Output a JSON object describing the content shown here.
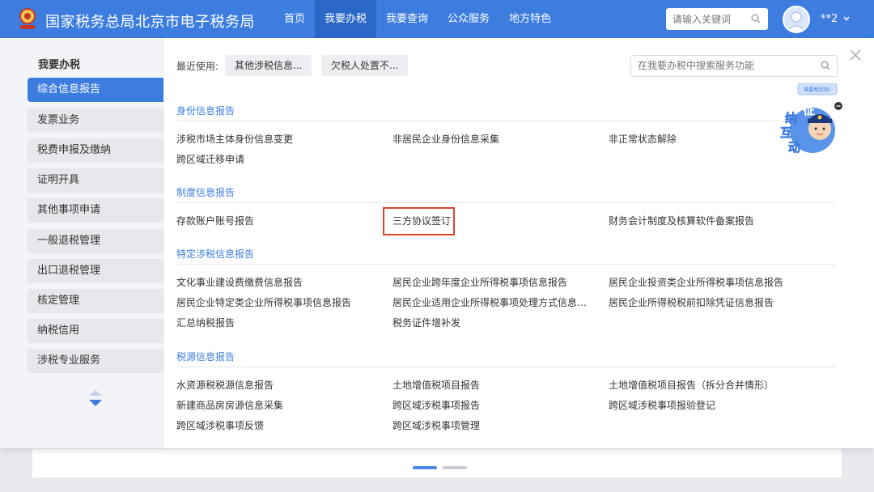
{
  "header": {
    "title": "国家税务总局北京市电子税务局",
    "nav": [
      "首页",
      "我要办税",
      "我要查询",
      "公众服务",
      "地方特色"
    ],
    "active_nav": "我要办税",
    "search_placeholder": "请输入关键词",
    "username": "**2"
  },
  "sidebar": {
    "title": "我要办税",
    "items": [
      "综合信息报告",
      "发票业务",
      "税费申报及缴纳",
      "证明开具",
      "其他事项申请",
      "一般退税管理",
      "出口退税管理",
      "核定管理",
      "纳税信用",
      "涉税专业服务"
    ],
    "active_item": "综合信息报告"
  },
  "toolbar": {
    "recent_label": "最近使用:",
    "recent_items": [
      "其他涉税信息...",
      "欠税人处置不..."
    ],
    "search_placeholder": "在我要办税中搜索服务功能"
  },
  "sections": [
    {
      "title": "身份信息报告",
      "links": [
        "涉税市场主体身份信息变更",
        "非居民企业身份信息采集",
        "非正常状态解除",
        "跨区域迁移申请"
      ]
    },
    {
      "title": "制度信息报告",
      "links": [
        "存款账户账号报告",
        "三方协议签订",
        "财务会计制度及核算软件备案报告"
      ]
    },
    {
      "title": "特定涉税信息报告",
      "links": [
        "文化事业建设费缴费信息报告",
        "居民企业跨年度企业所得税事项信息报告",
        "居民企业投资类企业所得税事项信息报告",
        "居民企业特定类企业所得税事项信息报告",
        "居民企业适用企业所得税事项处理方式信息报...",
        "居民企业所得税税前扣除凭证信息报告",
        "汇总纳税报告",
        "税务证件增补发"
      ]
    },
    {
      "title": "税源信息报告",
      "links": [
        "水资源税税源信息报告",
        "土地增值税项目报告",
        "土地增值税项目报告（拆分合并情形）",
        "新建商品房房源信息采集",
        "跨区域涉税事项报告",
        "跨区域涉税事项报验登记",
        "跨区域涉税事项反馈",
        "跨区域涉税事项管理"
      ]
    }
  ],
  "highlighted_link": "三方协议签订",
  "mascot": {
    "bubble": "需要帮您吗?",
    "text": [
      "征",
      "纳",
      "互",
      "动"
    ]
  },
  "colors": {
    "primary": "#3d7de0",
    "nav_active": "#2a67c7",
    "highlight": "#e0442f",
    "sidebar_bg": "#f2f4f7"
  }
}
